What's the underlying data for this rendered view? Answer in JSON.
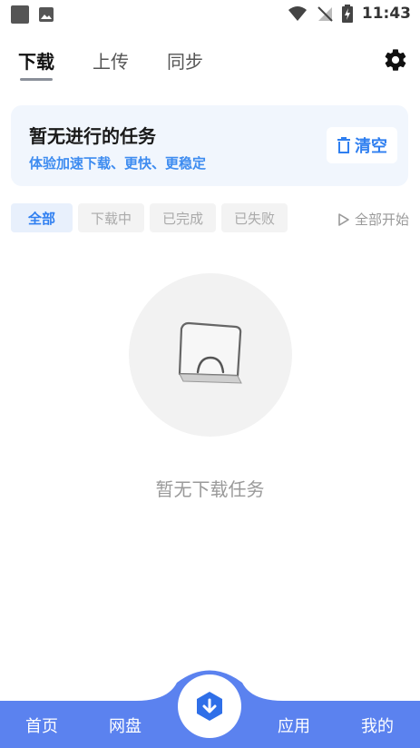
{
  "status_bar": {
    "time": "11:43"
  },
  "top_tabs": [
    {
      "label": "下载",
      "active": true
    },
    {
      "label": "上传",
      "active": false
    },
    {
      "label": "同步",
      "active": false
    }
  ],
  "card": {
    "title": "暂无进行的任务",
    "subtitle": "体验加速下载、更快、更稳定",
    "clear_label": "清空"
  },
  "filters": [
    {
      "label": "全部",
      "active": true
    },
    {
      "label": "下载中",
      "active": false
    },
    {
      "label": "已完成",
      "active": false
    },
    {
      "label": "已失败",
      "active": false
    }
  ],
  "start_all_label": "全部开始",
  "empty_text": "暂无下载任务",
  "bottom_nav": {
    "home": "首页",
    "disk": "网盘",
    "apps": "应用",
    "mine": "我的"
  },
  "colors": {
    "accent": "#2f7ff0",
    "nav_bg": "#5b82ef",
    "card_bg": "#f1f6fd"
  }
}
